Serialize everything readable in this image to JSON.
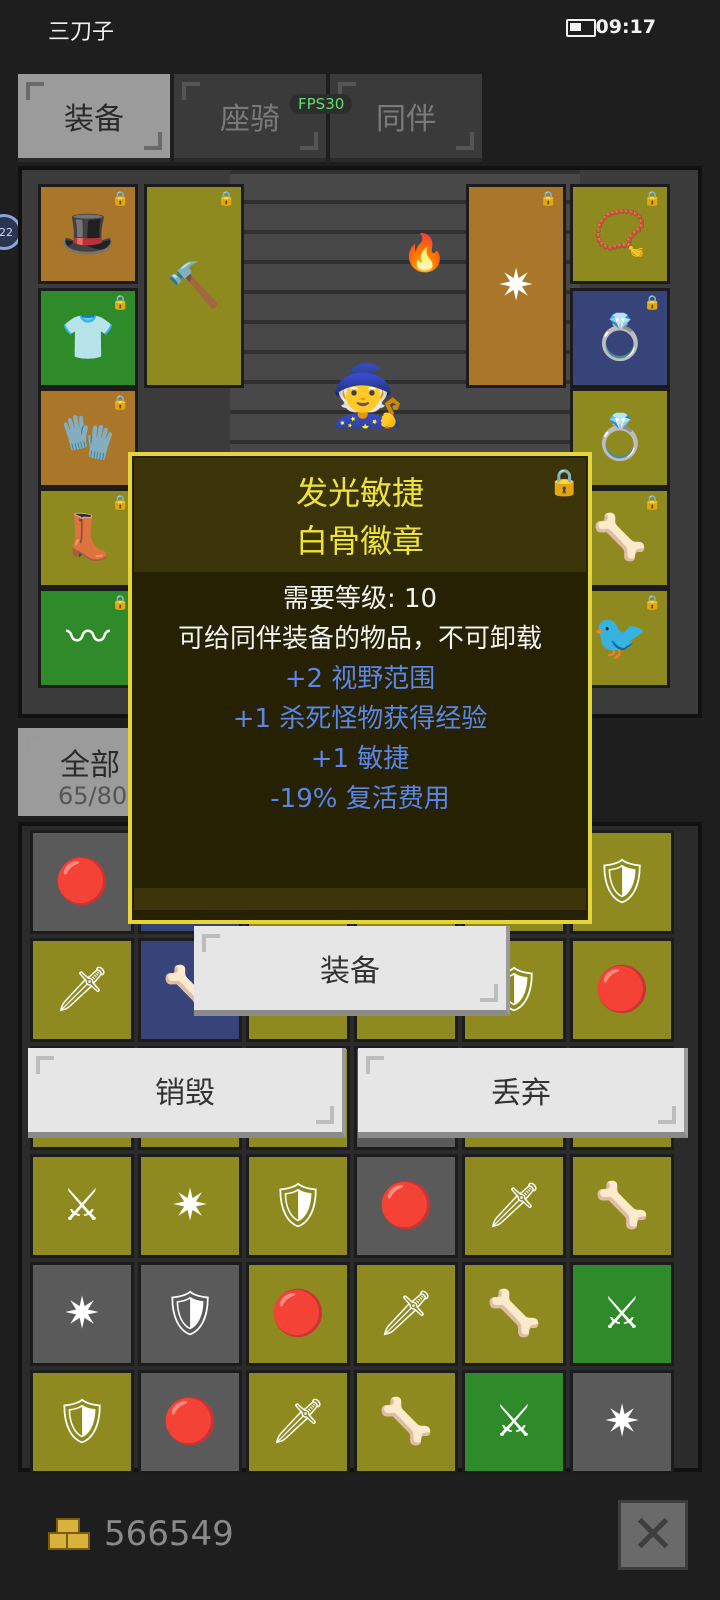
{
  "status_bar": {
    "carrier": "三刀子",
    "time": "09:17"
  },
  "tabs": [
    {
      "label": "装备",
      "active": true
    },
    {
      "label": "座骑",
      "active": false
    },
    {
      "label": "同伴",
      "active": false
    }
  ],
  "fps_badge": "FPS30",
  "side_badge": "22",
  "filter": {
    "label": "全部",
    "count": "65/80"
  },
  "tooltip": {
    "title_line1": "发光敏捷",
    "title_line2": "白骨徽章",
    "requirement": "需要等级: 10",
    "description": "可给同伴装备的物品，不可卸载",
    "stats": [
      "+2 视野范围",
      "+1 杀死怪物获得经验",
      "+1 敏捷",
      "-19% 复活费用"
    ]
  },
  "actions": {
    "equip": "装备",
    "destroy": "销毁",
    "discard": "丢弃"
  },
  "gold": "566549",
  "colors": {
    "tooltip_border": "#e6d536",
    "title": "#f0e23c",
    "stat": "#5a86e8",
    "fps": "#5fe06a"
  }
}
